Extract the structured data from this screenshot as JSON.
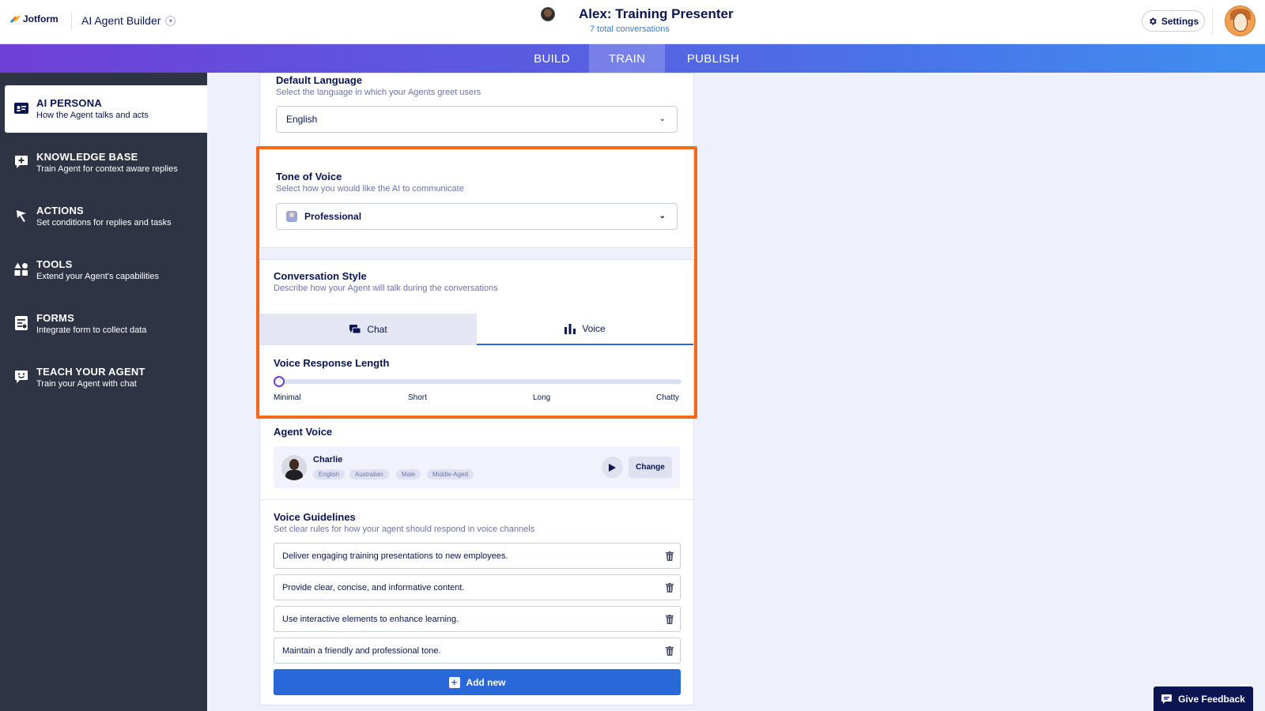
{
  "header": {
    "logo_text": "Jotform",
    "app_name": "AI Agent Builder",
    "agent_title": "Alex: Training Presenter",
    "agent_subtitle": "7 total conversations",
    "settings_label": "Settings"
  },
  "tabs": [
    {
      "label": "BUILD",
      "active": false
    },
    {
      "label": "TRAIN",
      "active": true
    },
    {
      "label": "PUBLISH",
      "active": false
    }
  ],
  "sidebar": {
    "items": [
      {
        "title": "AI PERSONA",
        "desc": "How the Agent talks and acts",
        "icon": "id-card-icon",
        "active": true
      },
      {
        "title": "KNOWLEDGE BASE",
        "desc": "Train Agent for context aware replies",
        "icon": "knowledge-plus-icon",
        "active": false
      },
      {
        "title": "ACTIONS",
        "desc": "Set conditions for replies and tasks",
        "icon": "flag-icon",
        "active": false
      },
      {
        "title": "TOOLS",
        "desc": "Extend your Agent's capabilities",
        "icon": "shapes-icon",
        "active": false
      },
      {
        "title": "FORMS",
        "desc": "Integrate form to collect data",
        "icon": "form-icon",
        "active": false
      },
      {
        "title": "TEACH YOUR AGENT",
        "desc": "Train your Agent with chat",
        "icon": "chat-smile-icon",
        "active": false
      }
    ]
  },
  "default_language": {
    "label": "Default Language",
    "desc": "Select the language in which your Agents greet users",
    "value": "English"
  },
  "tone_of_voice": {
    "label": "Tone of Voice",
    "desc": "Select how you would like the AI to communicate",
    "value": "Professional"
  },
  "conversation_style": {
    "label": "Conversation Style",
    "desc": "Describe how your Agent will talk during the conversations",
    "tabs": [
      {
        "label": "Chat",
        "active": false
      },
      {
        "label": "Voice",
        "active": true
      }
    ],
    "response_length": {
      "label": "Voice Response Length",
      "ticks": [
        "Minimal",
        "Short",
        "Long",
        "Chatty"
      ],
      "selected": "Minimal"
    }
  },
  "agent_voice": {
    "label": "Agent Voice",
    "name": "Charlie",
    "tags": [
      "English",
      "Australian",
      "Male",
      "Middle-Aged"
    ],
    "change_label": "Change"
  },
  "voice_guidelines": {
    "label": "Voice Guidelines",
    "desc": "Set clear rules for how your agent should respond in voice channels",
    "items": [
      "Deliver engaging training presentations to new employees.",
      "Provide clear, concise, and informative content.",
      "Use interactive elements to enhance learning.",
      "Maintain a friendly and professional tone."
    ],
    "add_label": "Add new"
  },
  "feedback_label": "Give Feedback",
  "colors": {
    "accent_purple": "#6f3fd8",
    "highlight_orange": "#f46a1c",
    "primary_blue": "#2868d8",
    "sidebar_bg": "#2f3444",
    "navy": "#0a1551"
  }
}
